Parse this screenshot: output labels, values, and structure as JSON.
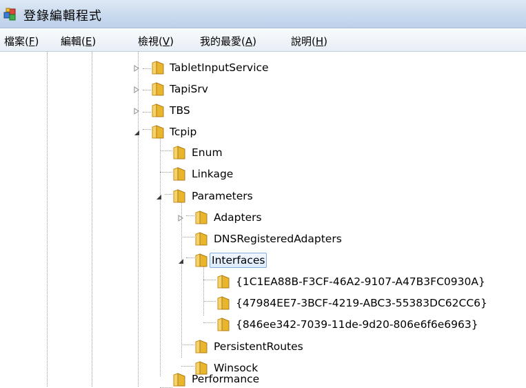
{
  "window": {
    "title": "登錄編輯程式"
  },
  "menu": [
    {
      "label": "檔案(",
      "key": "F",
      "tail": ")"
    },
    {
      "label": "編輯(",
      "key": "E",
      "tail": ")"
    },
    {
      "label": "檢視(",
      "key": "V",
      "tail": ")"
    },
    {
      "label": "我的最愛(",
      "key": "A",
      "tail": ")"
    },
    {
      "label": "說明(",
      "key": "H",
      "tail": ")"
    }
  ],
  "tree": {
    "nodes": [
      {
        "label": "TabletInputService",
        "expander": "collapsed"
      },
      {
        "label": "TapiSrv",
        "expander": "collapsed"
      },
      {
        "label": "TBS",
        "expander": "collapsed"
      },
      {
        "label": "Tcpip",
        "expander": "expanded"
      },
      {
        "label": "Enum",
        "expander": "none"
      },
      {
        "label": "Linkage",
        "expander": "none"
      },
      {
        "label": "Parameters",
        "expander": "expanded"
      },
      {
        "label": "Adapters",
        "expander": "collapsed"
      },
      {
        "label": "DNSRegisteredAdapters",
        "expander": "none"
      },
      {
        "label": "Interfaces",
        "expander": "expanded",
        "selected": true
      },
      {
        "label": "{1C1EA88B-F3CF-46A2-9107-A47B3FC0930A}",
        "expander": "none"
      },
      {
        "label": "{47984EE7-3BCF-4219-ABC3-55383DC62CC6}",
        "expander": "none"
      },
      {
        "label": "{846ee342-7039-11de-9d20-806e6f6e6963}",
        "expander": "none"
      },
      {
        "label": "PersistentRoutes",
        "expander": "none"
      },
      {
        "label": "Winsock",
        "expander": "none"
      },
      {
        "label": "Performance",
        "expander": "none"
      }
    ]
  },
  "colors": {
    "folder": "#e8b52f",
    "selection_border": "#84acdd",
    "title_bg": "#c9daee"
  }
}
